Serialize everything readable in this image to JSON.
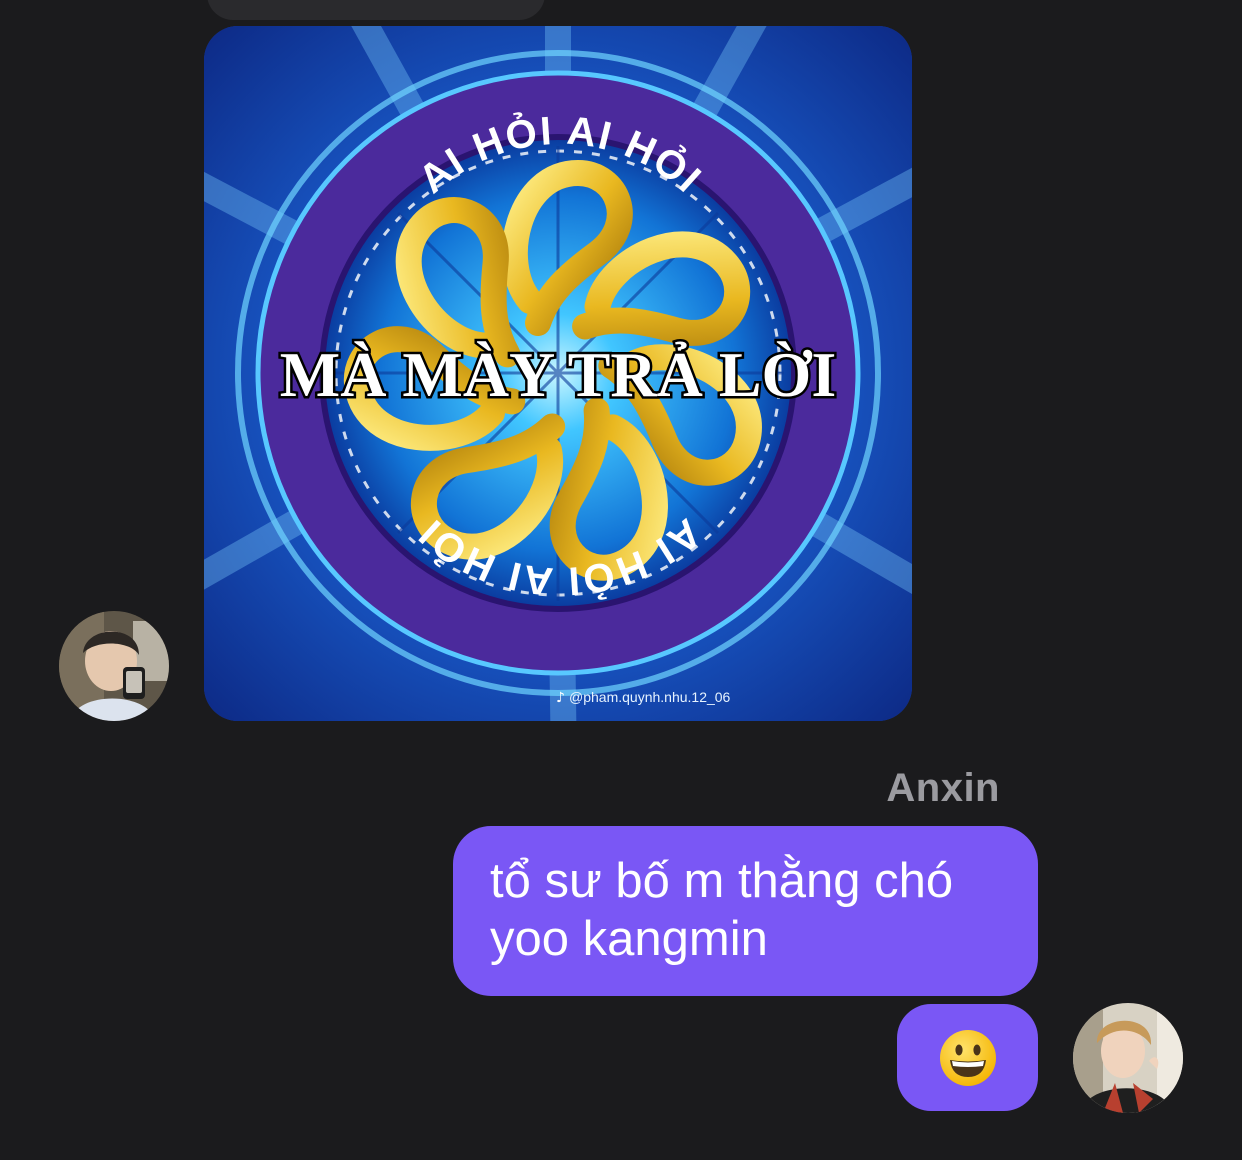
{
  "conversation": {
    "received": {
      "image_message": {
        "alt": "AI HỎI AI HỎI MÀ MÀY TRẢ LỜI",
        "top_arc_text": "AI HỎI AI HỎI",
        "center_text": "MÀ MÀY TRẢ LỜI",
        "bottom_arc_text": "AI HỎI AI HỎI",
        "watermark": "@pham.quynh.nhu.12_06",
        "watermark_icon": "tiktok-note-icon"
      },
      "avatar": "profile-photo"
    },
    "sent": {
      "sender_name": "Anxin",
      "text_message": "tổ sư bố m thằng chó yoo kangmin",
      "emoji_message": "grinning-face-emoji",
      "avatar": "profile-photo"
    }
  },
  "colors": {
    "background": "#1b1b1d",
    "outgoing_bubble": "#7a57f5",
    "sender_name": "#9b9ba0",
    "logo_purple": "#4b2a9c",
    "logo_gold": "#e9b820",
    "logo_blue": "#2c8fe0"
  }
}
